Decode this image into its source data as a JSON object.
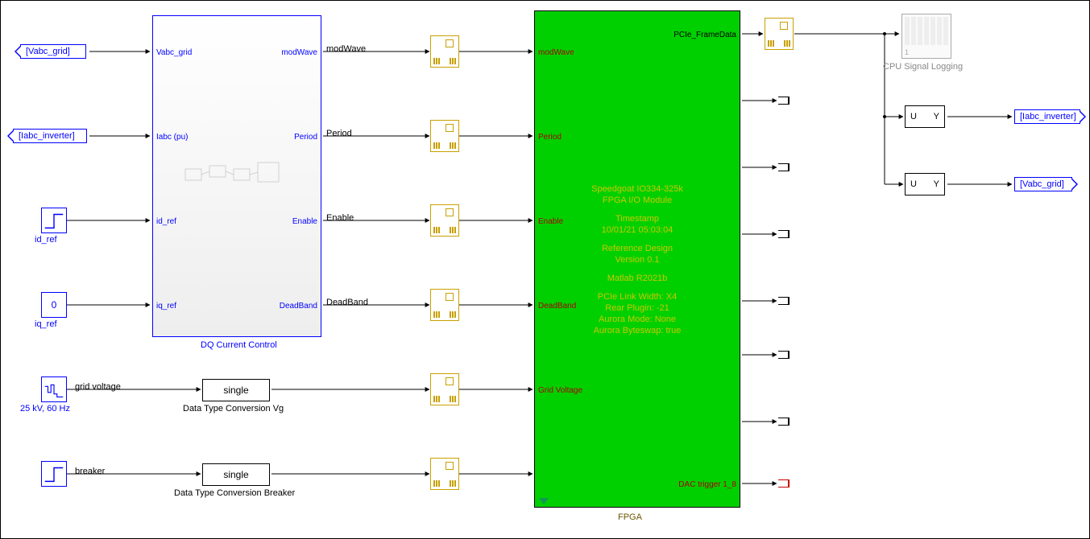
{
  "tags": {
    "vabc_grid_from": "[Vabc_grid]",
    "iabc_inv_from": "[Iabc_inverter]",
    "iabc_inv_goto": "[Iabc_inverter]",
    "vabc_grid_goto": "[Vabc_grid]"
  },
  "labels": {
    "id_ref": "id_ref",
    "iq_ref": "iq_ref",
    "iq_ref_val": "0",
    "source_25kv": "25 kV, 60 Hz",
    "grid_voltage": "grid voltage",
    "breaker": "breaker",
    "dtc_vg": "Data Type Conversion Vg",
    "dtc_breaker": "Data Type Conversion Breaker",
    "single": "single",
    "dq_title": "DQ Current Control",
    "fpga_title": "FPGA",
    "cpu_logging": "CPU Signal Logging",
    "scope_num": "1"
  },
  "dq_ports": {
    "in1": "Vabc_grid",
    "in2": "Iabc (pu)",
    "in3": "id_ref",
    "in4": "iq_ref",
    "out1": "modWave",
    "out2": "Period",
    "out3": "Enable",
    "out4": "DeadBand"
  },
  "signals": {
    "modwave": "modWave",
    "period": "Period",
    "enable": "Enable",
    "deadband": "DeadBand"
  },
  "fpga_ports": {
    "in1": "modWave",
    "in2": "Period",
    "in3": "Enable",
    "in4": "DeadBand",
    "in5": "Grid Voltage",
    "out_top": "PCIe_FrameData",
    "out_dac": "DAC trigger 1_8"
  },
  "fpga_text": {
    "l1": "Speedgoat IO334-325k",
    "l2": "FPGA I/O Module",
    "l3": "Timestamp",
    "l4": "10/01/21 05:03:04",
    "l5": "Reference Design",
    "l6": "Version 0.1",
    "l7": "Matlab R2021b",
    "l8": "PCIe Link Width: X4",
    "l9": "Rear Plugin: -21",
    "l10": "Aurora Mode: None",
    "l11": "Aurora Byteswap: true"
  },
  "uy": {
    "u": "U",
    "y": "Y"
  }
}
